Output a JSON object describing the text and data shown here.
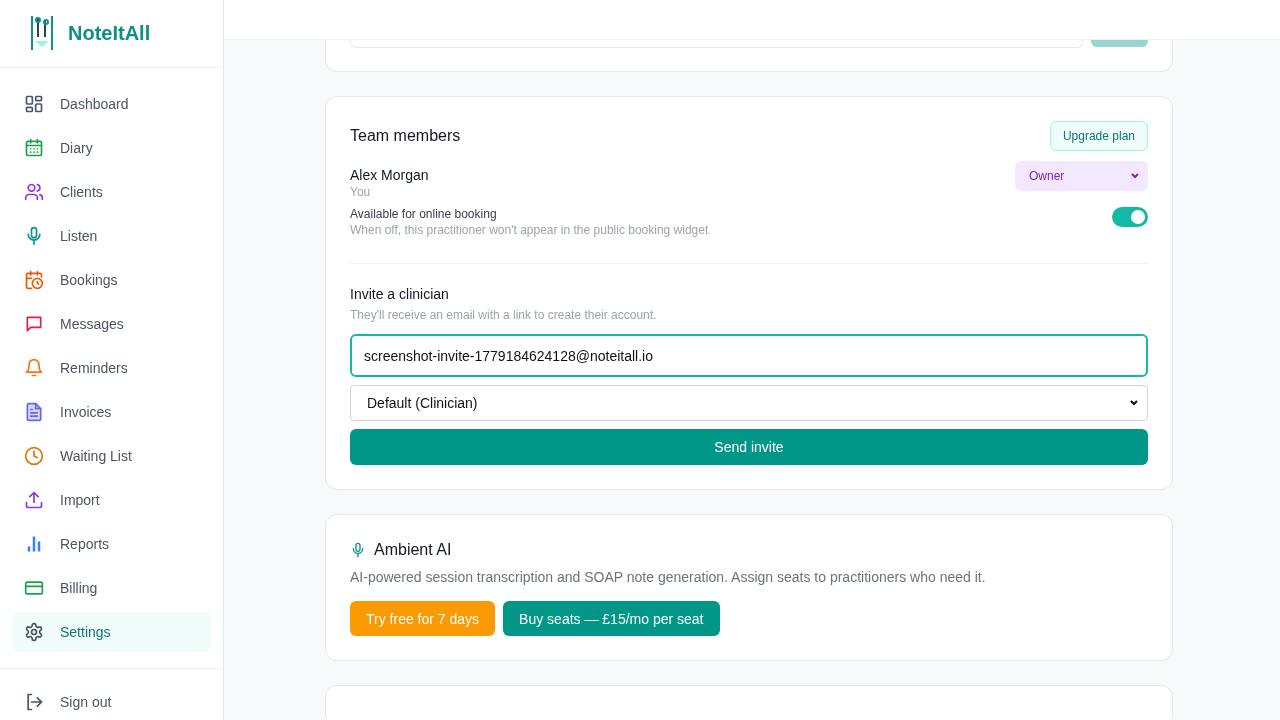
{
  "brand": "NoteItAll",
  "nav": [
    {
      "label": "Dashboard",
      "color": "#4b5563",
      "selected": false
    },
    {
      "label": "Diary",
      "color": "#16a34a",
      "selected": false
    },
    {
      "label": "Clients",
      "color": "#9333ea",
      "selected": false
    },
    {
      "label": "Listen",
      "color": "#0d9488",
      "selected": false
    },
    {
      "label": "Bookings",
      "color": "#ea580c",
      "selected": false
    },
    {
      "label": "Messages",
      "color": "#e11d48",
      "selected": false
    },
    {
      "label": "Reminders",
      "color": "#f97316",
      "selected": false
    },
    {
      "label": "Invoices",
      "color": "#6366f1",
      "selected": false
    },
    {
      "label": "Waiting List",
      "color": "#d97706",
      "selected": false
    },
    {
      "label": "Import",
      "color": "#9333ea",
      "selected": false
    },
    {
      "label": "Reports",
      "color": "#3b82f6",
      "selected": false
    },
    {
      "label": "Billing",
      "color": "#16a34a",
      "selected": false
    },
    {
      "label": "Settings",
      "color": "#4b5563",
      "selected": true
    }
  ],
  "sign_out": "Sign out",
  "team": {
    "title": "Team members",
    "upgrade": "Upgrade plan",
    "member": {
      "name": "Alex Morgan",
      "note": "You",
      "role": "Owner"
    },
    "booking": {
      "label": "Available for online booking",
      "hint": "When off, this practitioner won't appear in the public booking widget",
      "on": true
    },
    "invite": {
      "title": "Invite a clinician",
      "hint": "They'll receive an email with a link to create their account.",
      "email": "screenshot-invite-1779184624128@noteitall.io",
      "role": "Default (Clinician)",
      "button": "Send invite"
    }
  },
  "ambient": {
    "title": "Ambient AI",
    "text": "AI-powered session transcription and SOAP note generation. Assign seats to practitioners who need it.",
    "trial": "Try free for 7 days",
    "buy": "Buy seats — £15/mo per seat"
  }
}
